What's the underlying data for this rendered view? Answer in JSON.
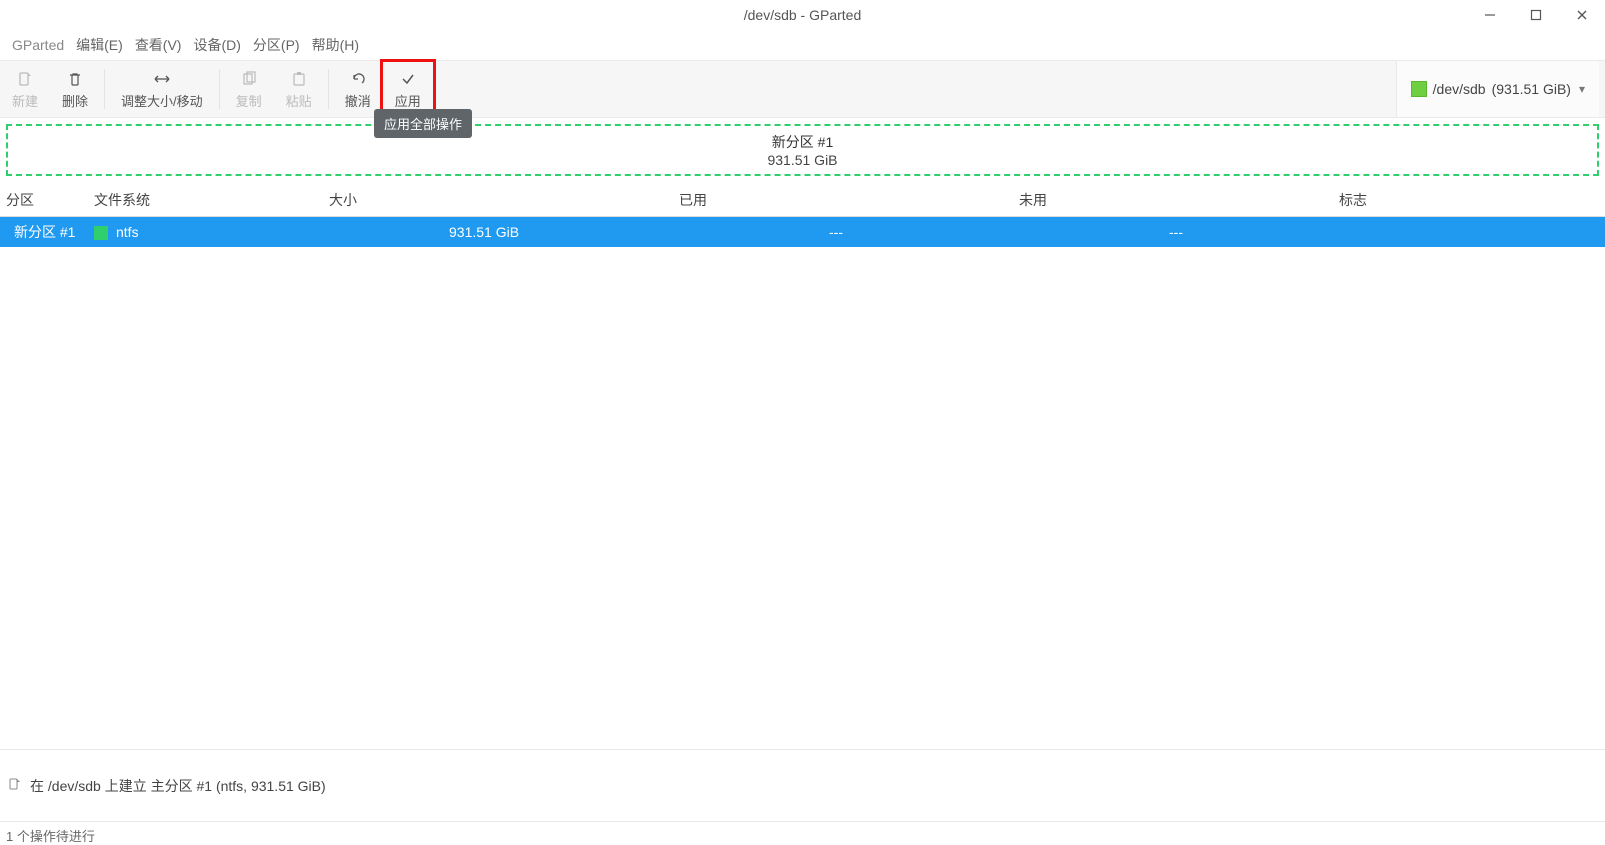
{
  "window": {
    "title": "/dev/sdb - GParted"
  },
  "menu": {
    "gparted": "GParted",
    "edit": "编辑(E)",
    "view": "查看(V)",
    "device": "设备(D)",
    "partition": "分区(P)",
    "help": "帮助(H)"
  },
  "toolbar": {
    "new": "新建",
    "delete": "删除",
    "resize": "调整大小/移动",
    "copy": "复制",
    "paste": "粘贴",
    "undo": "撤消",
    "apply": "应用",
    "tooltip_apply": "应用全部操作"
  },
  "device_selector": {
    "device": "/dev/sdb",
    "size": "(931.51 GiB)"
  },
  "partition_map": {
    "name": "新分区 #1",
    "size": "931.51 GiB"
  },
  "columns": {
    "partition": "分区",
    "filesystem": "文件系统",
    "size": "大小",
    "used": "已用",
    "unused": "未用",
    "flags": "标志"
  },
  "row": {
    "partition": "新分区 #1",
    "filesystem": "ntfs",
    "size": "931.51 GiB",
    "used": "---",
    "unused": "---",
    "flags": ""
  },
  "pending": {
    "op1": "在 /dev/sdb 上建立 主分区 #1 (ntfs, 931.51 GiB)"
  },
  "statusbar": {
    "text": "1 个操作待进行"
  }
}
